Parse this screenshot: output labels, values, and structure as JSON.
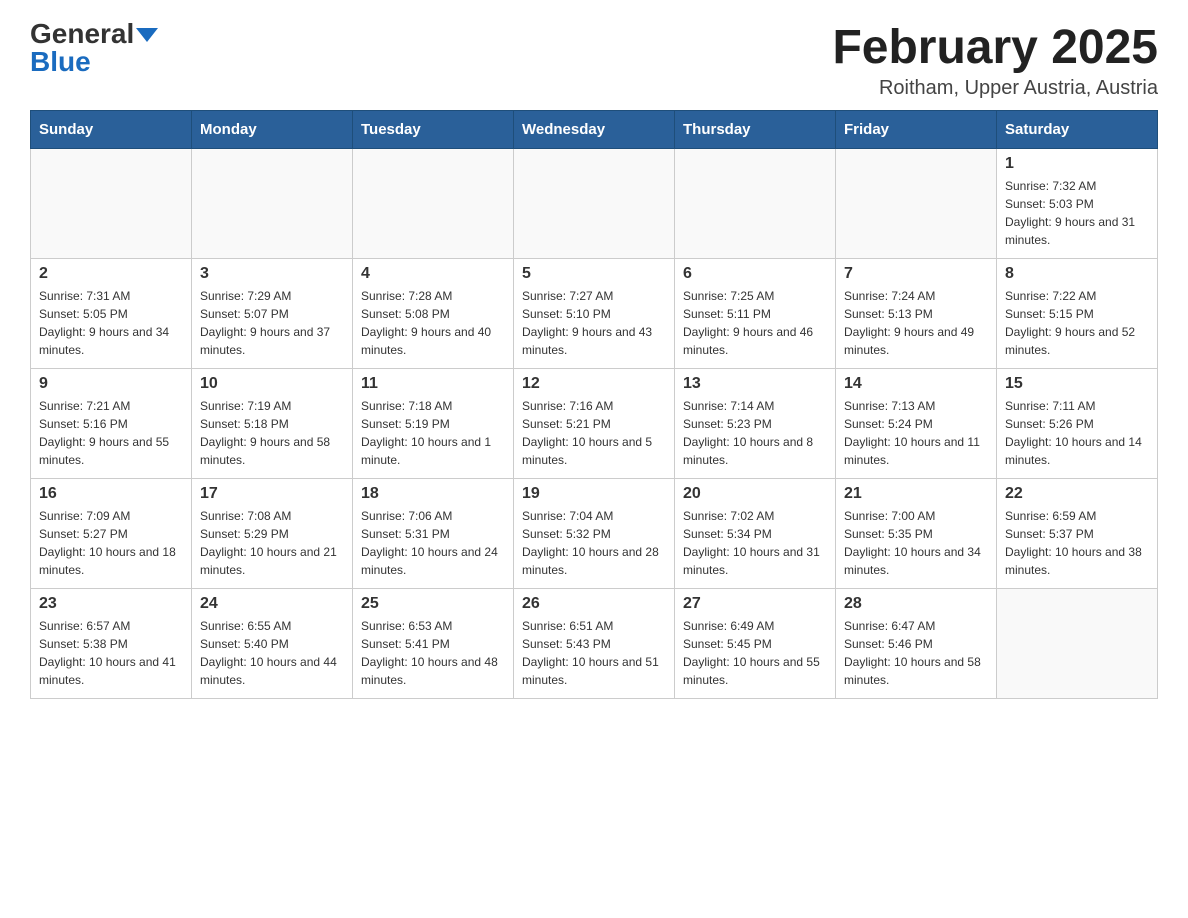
{
  "header": {
    "logo_general": "General",
    "logo_blue": "Blue",
    "month_year": "February 2025",
    "location": "Roitham, Upper Austria, Austria"
  },
  "days_of_week": [
    "Sunday",
    "Monday",
    "Tuesday",
    "Wednesday",
    "Thursday",
    "Friday",
    "Saturday"
  ],
  "weeks": [
    [
      {
        "day": "",
        "sunrise": "",
        "sunset": "",
        "daylight": "",
        "empty": true
      },
      {
        "day": "",
        "sunrise": "",
        "sunset": "",
        "daylight": "",
        "empty": true
      },
      {
        "day": "",
        "sunrise": "",
        "sunset": "",
        "daylight": "",
        "empty": true
      },
      {
        "day": "",
        "sunrise": "",
        "sunset": "",
        "daylight": "",
        "empty": true
      },
      {
        "day": "",
        "sunrise": "",
        "sunset": "",
        "daylight": "",
        "empty": true
      },
      {
        "day": "",
        "sunrise": "",
        "sunset": "",
        "daylight": "",
        "empty": true
      },
      {
        "day": "1",
        "sunrise": "Sunrise: 7:32 AM",
        "sunset": "Sunset: 5:03 PM",
        "daylight": "Daylight: 9 hours and 31 minutes.",
        "empty": false
      }
    ],
    [
      {
        "day": "2",
        "sunrise": "Sunrise: 7:31 AM",
        "sunset": "Sunset: 5:05 PM",
        "daylight": "Daylight: 9 hours and 34 minutes.",
        "empty": false
      },
      {
        "day": "3",
        "sunrise": "Sunrise: 7:29 AM",
        "sunset": "Sunset: 5:07 PM",
        "daylight": "Daylight: 9 hours and 37 minutes.",
        "empty": false
      },
      {
        "day": "4",
        "sunrise": "Sunrise: 7:28 AM",
        "sunset": "Sunset: 5:08 PM",
        "daylight": "Daylight: 9 hours and 40 minutes.",
        "empty": false
      },
      {
        "day": "5",
        "sunrise": "Sunrise: 7:27 AM",
        "sunset": "Sunset: 5:10 PM",
        "daylight": "Daylight: 9 hours and 43 minutes.",
        "empty": false
      },
      {
        "day": "6",
        "sunrise": "Sunrise: 7:25 AM",
        "sunset": "Sunset: 5:11 PM",
        "daylight": "Daylight: 9 hours and 46 minutes.",
        "empty": false
      },
      {
        "day": "7",
        "sunrise": "Sunrise: 7:24 AM",
        "sunset": "Sunset: 5:13 PM",
        "daylight": "Daylight: 9 hours and 49 minutes.",
        "empty": false
      },
      {
        "day": "8",
        "sunrise": "Sunrise: 7:22 AM",
        "sunset": "Sunset: 5:15 PM",
        "daylight": "Daylight: 9 hours and 52 minutes.",
        "empty": false
      }
    ],
    [
      {
        "day": "9",
        "sunrise": "Sunrise: 7:21 AM",
        "sunset": "Sunset: 5:16 PM",
        "daylight": "Daylight: 9 hours and 55 minutes.",
        "empty": false
      },
      {
        "day": "10",
        "sunrise": "Sunrise: 7:19 AM",
        "sunset": "Sunset: 5:18 PM",
        "daylight": "Daylight: 9 hours and 58 minutes.",
        "empty": false
      },
      {
        "day": "11",
        "sunrise": "Sunrise: 7:18 AM",
        "sunset": "Sunset: 5:19 PM",
        "daylight": "Daylight: 10 hours and 1 minute.",
        "empty": false
      },
      {
        "day": "12",
        "sunrise": "Sunrise: 7:16 AM",
        "sunset": "Sunset: 5:21 PM",
        "daylight": "Daylight: 10 hours and 5 minutes.",
        "empty": false
      },
      {
        "day": "13",
        "sunrise": "Sunrise: 7:14 AM",
        "sunset": "Sunset: 5:23 PM",
        "daylight": "Daylight: 10 hours and 8 minutes.",
        "empty": false
      },
      {
        "day": "14",
        "sunrise": "Sunrise: 7:13 AM",
        "sunset": "Sunset: 5:24 PM",
        "daylight": "Daylight: 10 hours and 11 minutes.",
        "empty": false
      },
      {
        "day": "15",
        "sunrise": "Sunrise: 7:11 AM",
        "sunset": "Sunset: 5:26 PM",
        "daylight": "Daylight: 10 hours and 14 minutes.",
        "empty": false
      }
    ],
    [
      {
        "day": "16",
        "sunrise": "Sunrise: 7:09 AM",
        "sunset": "Sunset: 5:27 PM",
        "daylight": "Daylight: 10 hours and 18 minutes.",
        "empty": false
      },
      {
        "day": "17",
        "sunrise": "Sunrise: 7:08 AM",
        "sunset": "Sunset: 5:29 PM",
        "daylight": "Daylight: 10 hours and 21 minutes.",
        "empty": false
      },
      {
        "day": "18",
        "sunrise": "Sunrise: 7:06 AM",
        "sunset": "Sunset: 5:31 PM",
        "daylight": "Daylight: 10 hours and 24 minutes.",
        "empty": false
      },
      {
        "day": "19",
        "sunrise": "Sunrise: 7:04 AM",
        "sunset": "Sunset: 5:32 PM",
        "daylight": "Daylight: 10 hours and 28 minutes.",
        "empty": false
      },
      {
        "day": "20",
        "sunrise": "Sunrise: 7:02 AM",
        "sunset": "Sunset: 5:34 PM",
        "daylight": "Daylight: 10 hours and 31 minutes.",
        "empty": false
      },
      {
        "day": "21",
        "sunrise": "Sunrise: 7:00 AM",
        "sunset": "Sunset: 5:35 PM",
        "daylight": "Daylight: 10 hours and 34 minutes.",
        "empty": false
      },
      {
        "day": "22",
        "sunrise": "Sunrise: 6:59 AM",
        "sunset": "Sunset: 5:37 PM",
        "daylight": "Daylight: 10 hours and 38 minutes.",
        "empty": false
      }
    ],
    [
      {
        "day": "23",
        "sunrise": "Sunrise: 6:57 AM",
        "sunset": "Sunset: 5:38 PM",
        "daylight": "Daylight: 10 hours and 41 minutes.",
        "empty": false
      },
      {
        "day": "24",
        "sunrise": "Sunrise: 6:55 AM",
        "sunset": "Sunset: 5:40 PM",
        "daylight": "Daylight: 10 hours and 44 minutes.",
        "empty": false
      },
      {
        "day": "25",
        "sunrise": "Sunrise: 6:53 AM",
        "sunset": "Sunset: 5:41 PM",
        "daylight": "Daylight: 10 hours and 48 minutes.",
        "empty": false
      },
      {
        "day": "26",
        "sunrise": "Sunrise: 6:51 AM",
        "sunset": "Sunset: 5:43 PM",
        "daylight": "Daylight: 10 hours and 51 minutes.",
        "empty": false
      },
      {
        "day": "27",
        "sunrise": "Sunrise: 6:49 AM",
        "sunset": "Sunset: 5:45 PM",
        "daylight": "Daylight: 10 hours and 55 minutes.",
        "empty": false
      },
      {
        "day": "28",
        "sunrise": "Sunrise: 6:47 AM",
        "sunset": "Sunset: 5:46 PM",
        "daylight": "Daylight: 10 hours and 58 minutes.",
        "empty": false
      },
      {
        "day": "",
        "sunrise": "",
        "sunset": "",
        "daylight": "",
        "empty": true
      }
    ]
  ]
}
